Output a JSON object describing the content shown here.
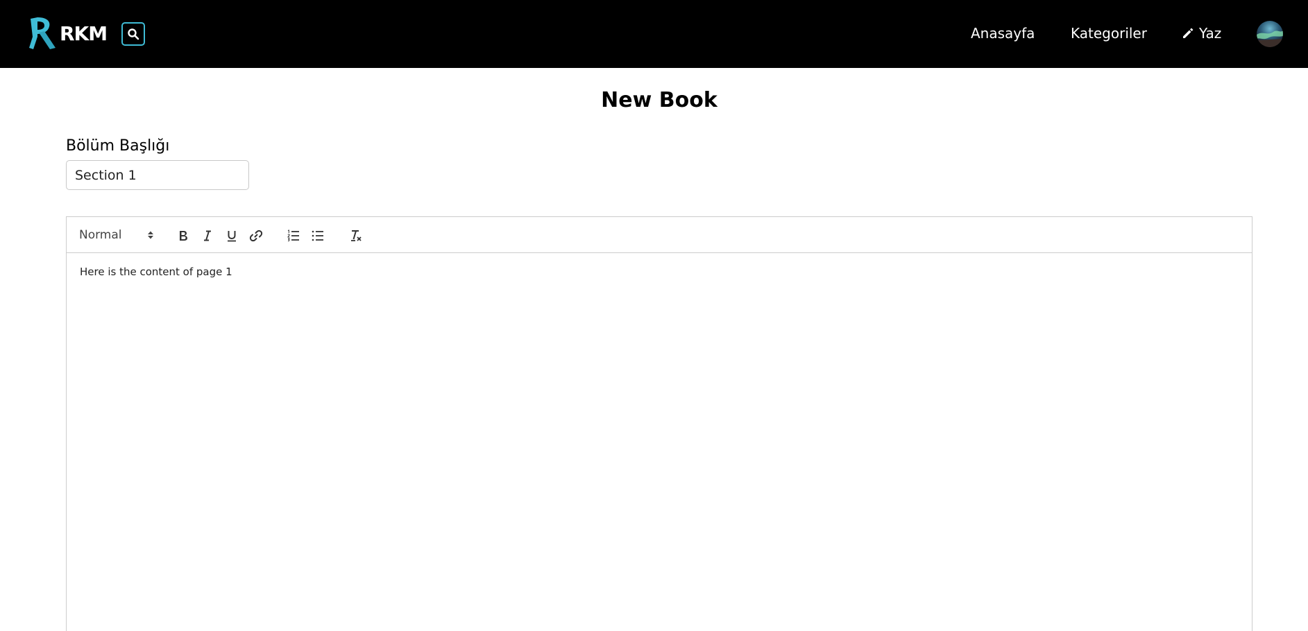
{
  "navbar": {
    "brand": "RKM",
    "links": {
      "home": "Anasayfa",
      "categories": "Kategoriler",
      "write": "Yaz"
    },
    "accent_color": "#3fbcd6",
    "background_color": "#000000",
    "icons": {
      "logo": "rkm-logo-icon",
      "search": "search-icon",
      "write": "pencil-icon",
      "avatar": "user-avatar"
    }
  },
  "page": {
    "title": "New Book"
  },
  "form": {
    "section_label": "Bölüm Başlığı",
    "section_value": "Section 1"
  },
  "editor": {
    "toolbar": {
      "format_select": "Normal",
      "buttons": [
        "bold-icon",
        "italic-icon",
        "underline-icon",
        "link-icon",
        "ordered-list-icon",
        "bullet-list-icon",
        "clear-format-icon"
      ]
    },
    "content": "Here is the content of page 1"
  }
}
